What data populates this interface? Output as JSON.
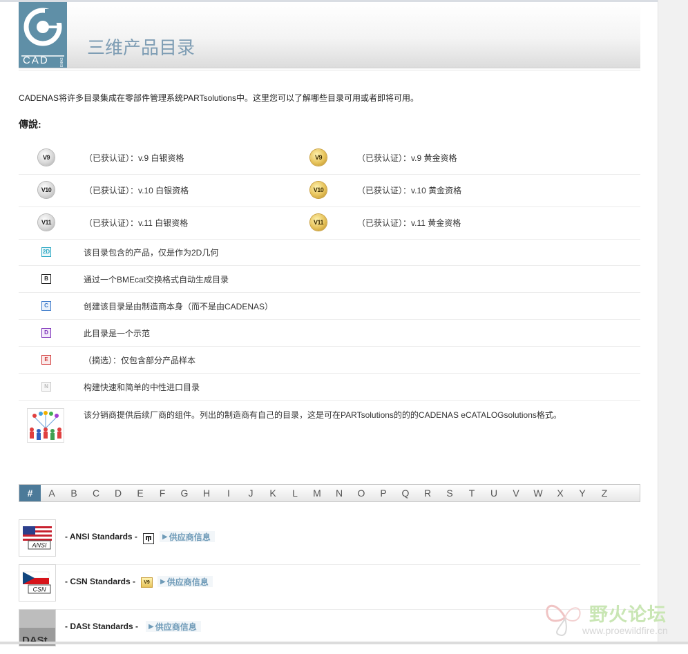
{
  "header": {
    "title": "三维产品目录",
    "logo_text": "CAD",
    "logo_subtext": "ENAS"
  },
  "intro": "CADENAS将许多目录集成在零部件管理系统PARTsolutions中。这里您可以了解哪些目录可用或者即将可用。",
  "legend_heading": "傳說:",
  "certification_rows": [
    {
      "left_badge": "V9",
      "left_text": "（已获认证）：v.9 白银资格",
      "right_badge": "V9",
      "right_text": "（已获认证）：v.9 黄金资格"
    },
    {
      "left_badge": "V10",
      "left_text": "（已获认证）：v.10 白银资格",
      "right_badge": "V10",
      "right_text": "（已获认证）：v.10 黄金资格"
    },
    {
      "left_badge": "V11",
      "left_text": "（已获认证）：v.11 白银资格",
      "right_badge": "V11",
      "right_text": "（已获认证）：v.11 黄金资格"
    }
  ],
  "letter_legend": [
    {
      "letter": "2D",
      "text": "该目录包含的产品，仅是作为2D几何",
      "color": "#2aa8c4"
    },
    {
      "letter": "B",
      "text": "通过一个BMEcat交换格式自动生成目录",
      "color": "#222222"
    },
    {
      "letter": "C",
      "text": "创建该目录是由制造商本身（而不是由CADENAS）",
      "color": "#3a78c9"
    },
    {
      "letter": "D",
      "text": "此目录是一个示范",
      "color": "#7a2bb8"
    },
    {
      "letter": "E",
      "text": "（摘选）：仅包含部分产品样本",
      "color": "#d23a3a"
    },
    {
      "letter": "N",
      "text": "构建快速和简单的中性进口目录",
      "color": "#bbbbbb"
    }
  ],
  "distributor_text": "该分销商提供后续厂商的组件。列出的制造商有自己的目录，这是可在PARTsolutions的的的CADENAS eCATALOGsolutions格式。",
  "alphabet": [
    "#",
    "A",
    "B",
    "C",
    "D",
    "E",
    "F",
    "G",
    "H",
    "I",
    "J",
    "K",
    "L",
    "M",
    "N",
    "O",
    "P",
    "Q",
    "R",
    "S",
    "T",
    "U",
    "V",
    "W",
    "X",
    "Y",
    "Z"
  ],
  "alphabet_active": "#",
  "catalogs": [
    {
      "name": "- ANSI Standards -",
      "thumb_label": "ANSI",
      "badge": "distributor-icon",
      "link": "供应商信息"
    },
    {
      "name": "- CSN Standards -",
      "thumb_label": "CSN",
      "badge": "V9",
      "link": "供应商信息"
    },
    {
      "name": "- DASt Standards -",
      "thumb_label": "DASt",
      "badge": "",
      "link": "供应商信息"
    }
  ],
  "watermark": {
    "cn": "野火论坛",
    "url": "www.proewildfire.cn"
  },
  "colors": {
    "accent": "#4c7a99",
    "title": "#7e9db4",
    "link": "#6f9bb8",
    "logo_bg": "#5f8fa7"
  }
}
